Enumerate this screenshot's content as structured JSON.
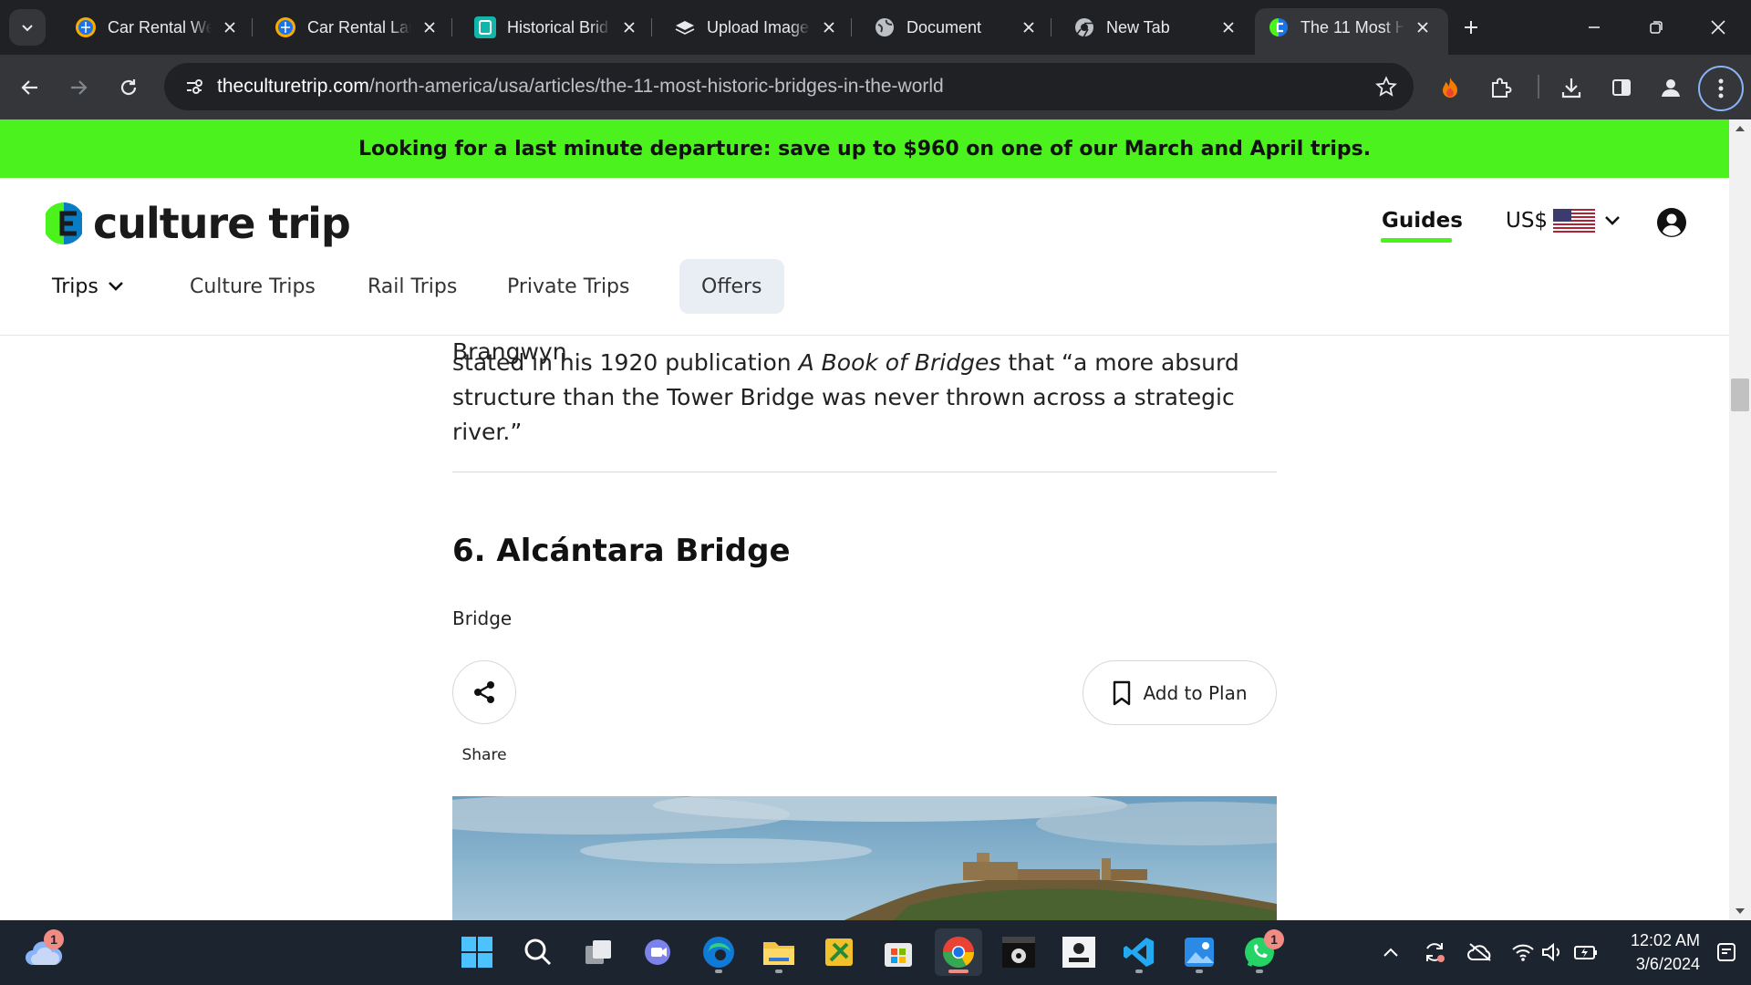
{
  "browser": {
    "tabs": [
      {
        "title": "Car Rental We",
        "icon": "globe-badge-icon"
      },
      {
        "title": "Car Rental Lar",
        "icon": "globe-badge-icon"
      },
      {
        "title": "Historical Brid",
        "icon": "document-d-icon"
      },
      {
        "title": "Upload Image",
        "icon": "stack-icon"
      },
      {
        "title": "Document",
        "icon": "globe-icon"
      },
      {
        "title": "New Tab",
        "icon": "chrome-icon"
      },
      {
        "title": "The 11 Most H",
        "icon": "culture-trip-icon",
        "active": true
      }
    ],
    "url_domain": "theculturetrip.com",
    "url_path": "/north-america/usa/articles/the-11-most-historic-bridges-in-the-world"
  },
  "promo": {
    "text": "Looking for a last minute departure: save up to $960 on one of our March and April trips.",
    "color": "#4cf21e"
  },
  "header": {
    "logo_text": "culture trip",
    "guides": "Guides",
    "currency": "US$",
    "nav": [
      "Trips",
      "Culture Trips",
      "Rail Trips",
      "Private Trips",
      "Offers"
    ]
  },
  "article": {
    "para_line0": "landmarks, it wasn’t always so loved — in fact, English artist Frank Brangwyn",
    "para_line1_a": "stated in his 1920 publication ",
    "para_line1_b": "A Book of Bridges",
    "para_line1_c": " that “a more absurd",
    "para_line2": "structure than the Tower Bridge was never thrown across a strategic river.”",
    "heading": "6. Alcántara Bridge",
    "category": "Bridge",
    "share": "Share",
    "add_to_plan": "Add to Plan"
  },
  "taskbar": {
    "weather_badge": "1",
    "whatsapp_badge": "1",
    "time": "12:02 AM",
    "date": "3/6/2024"
  }
}
